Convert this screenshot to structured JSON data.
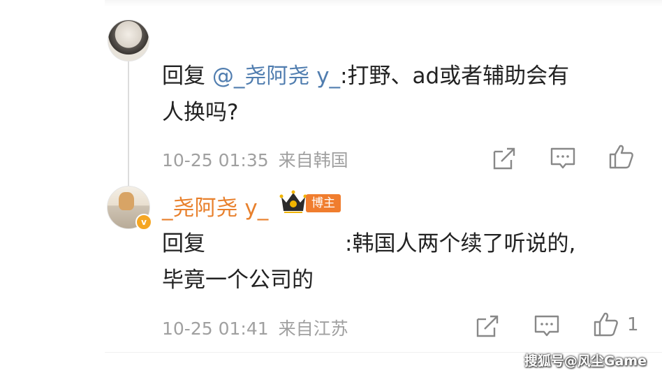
{
  "comment1": {
    "reply_prefix": "回复",
    "mention": "@_尧阿尧 y_",
    "body_line1": ":打野、ad或者辅助会有",
    "body_line2": "人换吗?",
    "timestamp": "10-25 01:35",
    "location": "来自韩国"
  },
  "comment2": {
    "username": "_尧阿尧 y_",
    "badge": "博主",
    "reply_prefix": "回复",
    "body_line1": ":韩国人两个续了听说的,",
    "body_line2": "毕竟一个公司的",
    "timestamp": "10-25 01:41",
    "location": "来自江苏",
    "like_count": "1"
  },
  "watermark": "搜狐号@风尘Game",
  "icons": {
    "share": "share-icon",
    "comment": "comment-icon",
    "like": "thumbs-up-icon"
  },
  "colors": {
    "mention": "#507daf",
    "username": "#e8802c",
    "badge": "#f07d2e",
    "meta": "#a0a0a0"
  }
}
